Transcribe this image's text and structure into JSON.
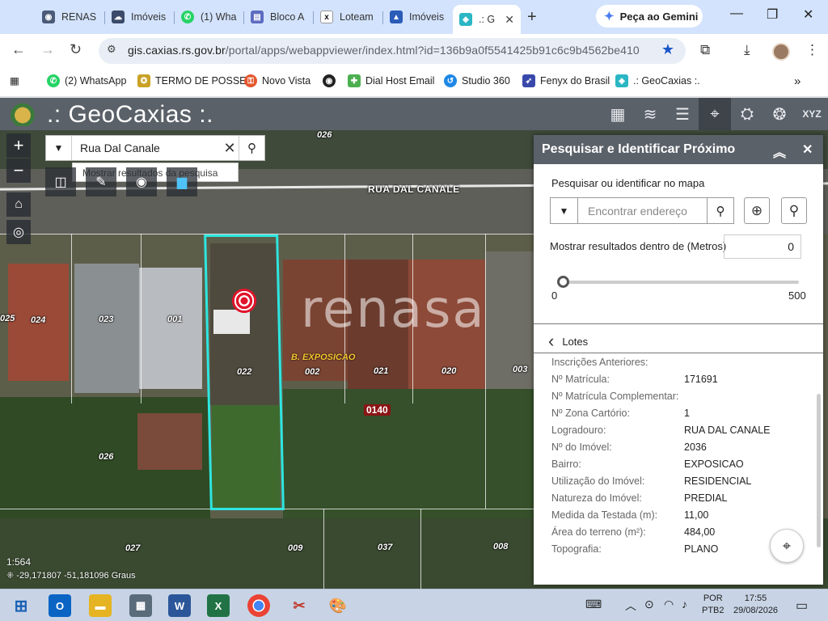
{
  "browser": {
    "tabs": [
      {
        "label": "RENAS",
        "icon": "globe-icon",
        "color": "#4a5a78"
      },
      {
        "label": "Imóveis",
        "icon": "cloud-icon",
        "color": "#3b4a6a"
      },
      {
        "label": "(1) Wha",
        "icon": "whatsapp-icon",
        "color": "#25d366"
      },
      {
        "label": "Bloco A",
        "icon": "doc-icon",
        "color": "#5c6bc0"
      },
      {
        "label": "Loteam",
        "icon": "x-icon",
        "color": "#111111"
      },
      {
        "label": "Imóveis",
        "icon": "map-icon",
        "color": "#2a5cb8"
      },
      {
        "label": ".: G",
        "icon": "geocaxias-icon",
        "color": "#2bb6c4",
        "active": true
      }
    ],
    "gemini_label": "Peça ao Gemini",
    "url_host": "gis.caxias.rs.gov.br",
    "url_path": "/portal/apps/webappviewer/index.html?id=136b9a0f5541425b91c6c9b4562be410",
    "bookmarks": [
      {
        "label": "(2) WhatsApp",
        "color": "#25d366"
      },
      {
        "label": "TERMO DE POSSE",
        "color": "#c9a227"
      },
      {
        "label": "Novo Vista",
        "color": "#e4572e"
      },
      {
        "label": "",
        "color": "#222222"
      },
      {
        "label": "Dial Host Email",
        "color": "#4caf50"
      },
      {
        "label": "Studio 360",
        "color": "#1e88e5"
      },
      {
        "label": "Fenyx do Brasil",
        "color": "#3949ab"
      },
      {
        "label": ".: GeoCaxias :.",
        "color": "#2bb6c4"
      }
    ]
  },
  "app": {
    "title": ".: GeoCaxias :.",
    "header_tools": [
      "basemap-gallery-icon",
      "layers-icon",
      "legend-list-icon",
      "identify-icon",
      "measure-icon",
      "film-icon",
      "xyz-icon"
    ]
  },
  "map": {
    "search_value": "Rua Dal Canale",
    "search_hint": "Mostrar resultados da pesquisa",
    "street_label": "RUA DAL CANALE",
    "bairro_label": "B. EXPOSICAO",
    "quadra_label": "0140",
    "watermark": "renasa",
    "lot_labels": [
      "026",
      "025",
      "024",
      "023",
      "001",
      "022",
      "002",
      "021",
      "020",
      "003",
      "026",
      "027",
      "009",
      "037",
      "008"
    ],
    "scale": "1:564",
    "coords": "-29,171807 -51,181096 Graus"
  },
  "panel": {
    "title": "Pesquisar e Identificar Próximo",
    "subtitle": "Pesquisar ou identificar no mapa",
    "placeholder": "Encontrar endereço",
    "distance_label": "Mostrar resultados dentro de (Metros)",
    "distance_value": "0",
    "slider_min": "0",
    "slider_max": "500",
    "slider_value": 0,
    "section": "Lotes",
    "attributes": [
      {
        "k": "Inscrições Anteriores:",
        "v": ""
      },
      {
        "k": "Nº Matrícula:",
        "v": "171691"
      },
      {
        "k": "Nº Matrícula Complementar:",
        "v": ""
      },
      {
        "k": "Nº Zona Cartório:",
        "v": "1"
      },
      {
        "k": "Logradouro:",
        "v": "RUA DAL CANALE"
      },
      {
        "k": "Nº do Imóvel:",
        "v": "2036"
      },
      {
        "k": "Bairro:",
        "v": "EXPOSICAO"
      },
      {
        "k": "Utilização do Imóvel:",
        "v": "RESIDENCIAL"
      },
      {
        "k": "Natureza do Imóvel:",
        "v": "PREDIAL"
      },
      {
        "k": "Medida da Testada (m):",
        "v": "11,00"
      },
      {
        "k": "Área do terreno (m²):",
        "v": "484,00"
      },
      {
        "k": "Topografia:",
        "v": "PLANO"
      }
    ]
  },
  "taskbar": {
    "lang1": "POR",
    "lang2": "PTB2",
    "time": "17:55",
    "date": "29/08/2026"
  }
}
